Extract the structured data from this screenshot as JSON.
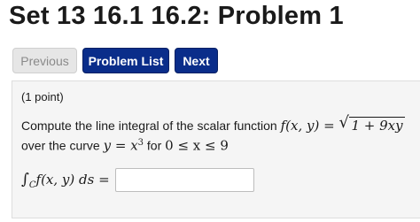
{
  "page_title": "Set 13 16.1 16.2: Problem 1",
  "nav": {
    "previous_label": "Previous",
    "problem_list_label": "Problem List",
    "next_label": "Next"
  },
  "problem": {
    "points": "(1 point)",
    "line1_text": "Compute the line integral of the scalar function ",
    "function_lhs": "f(x, y) = ",
    "radicand": "1 + 9xy",
    "line2_prefix": "over the curve ",
    "curve_eq": "y = x",
    "curve_exp": "3",
    "for_text": " for ",
    "range": "0 ≤ x ≤ 9",
    "integral_sign": "∫",
    "integral_sub": "C",
    "integral_body": "f(x, y) ds =",
    "answer_value": "",
    "answer_placeholder": ""
  },
  "colors": {
    "primary_button": "#0a2d8a",
    "disabled_button": "#e6e6e6",
    "problem_background": "#f5f5f5"
  }
}
